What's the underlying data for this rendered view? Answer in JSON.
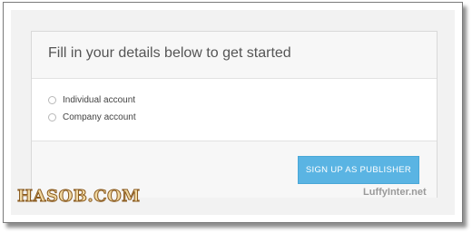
{
  "form": {
    "title": "Fill in your details below to get started",
    "options": [
      {
        "label": "Individual account",
        "selected": false
      },
      {
        "label": "Company account",
        "selected": false
      }
    ],
    "submit_label": "SIGN UP AS PUBLISHER"
  },
  "watermarks": {
    "left": "HASOB.COM",
    "right": "LuffyInter.net"
  },
  "colors": {
    "button": "#5ab4e3",
    "card_header_bg": "#f7f7f7",
    "page_bg": "#f2f2f2"
  },
  "icons": {
    "radio": "radio-unchecked-icon"
  }
}
